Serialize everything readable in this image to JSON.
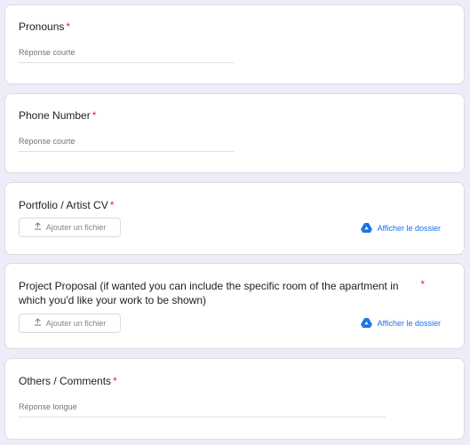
{
  "questions": [
    {
      "title": "Pronouns",
      "required": "*",
      "placeholder": "Réponse courte"
    },
    {
      "title": "Phone Number",
      "required": "*",
      "placeholder": "Réponse courte"
    },
    {
      "title": "Portfolio / Artist CV",
      "required": "*",
      "upload_label": "Ajouter un fichier",
      "drive_label": "Afficher le dossier"
    },
    {
      "title": "Project Proposal (if wanted you can include the specific room of the apartment in which you'd like your work to be shown)",
      "required": "*",
      "upload_label": "Ajouter un fichier",
      "drive_label": "Afficher le dossier"
    },
    {
      "title": "Others / Comments",
      "required": "*",
      "placeholder": "Réponse longue"
    }
  ],
  "icons": {
    "upload": "upload-icon",
    "drive": "google-drive-icon"
  },
  "colors": {
    "required": "#d93025",
    "link": "#1a73e8",
    "background": "#f0ebf8"
  }
}
